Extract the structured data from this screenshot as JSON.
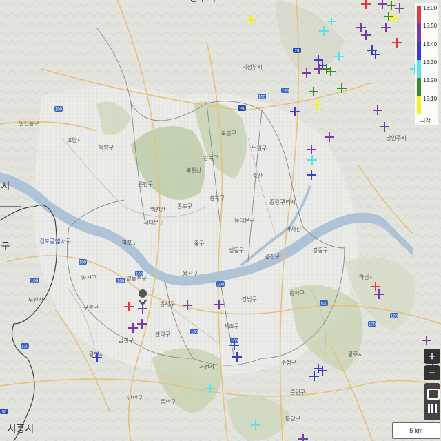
{
  "legend": {
    "caption": "시각",
    "ticks": [
      {
        "label": "16:00",
        "color": "#e8373a"
      },
      {
        "label": "15:50",
        "color": "#7a3aa8"
      },
      {
        "label": "15:40",
        "color": "#3a3ad8"
      },
      {
        "label": "15:30",
        "color": "#5de0e8"
      },
      {
        "label": "15:20",
        "color": "#3a8a2a"
      },
      {
        "label": "15:10",
        "color": "#f4f02a"
      }
    ]
  },
  "controls": {
    "zoom_in": "+",
    "zoom_out": "−"
  },
  "scale": {
    "label": "5 km"
  },
  "place_labels": [
    {
      "text": "의정부시",
      "size": "small"
    },
    {
      "text": "일산동구",
      "size": "small"
    },
    {
      "text": "고양시",
      "size": "small"
    },
    {
      "text": "덕양구",
      "size": "small"
    },
    {
      "text": "도봉구",
      "size": "small"
    },
    {
      "text": "노원구",
      "size": "small"
    },
    {
      "text": "강북구",
      "size": "small"
    },
    {
      "text": "은평구",
      "size": "small"
    },
    {
      "text": "성북구",
      "size": "small"
    },
    {
      "text": "종로구",
      "size": "small"
    },
    {
      "text": "중랑구",
      "size": "small"
    },
    {
      "text": "서대문구",
      "size": "small"
    },
    {
      "text": "동대문구",
      "size": "small"
    },
    {
      "text": "구리시",
      "size": "small"
    },
    {
      "text": "마포구",
      "size": "small"
    },
    {
      "text": "중구",
      "size": "small"
    },
    {
      "text": "성동구",
      "size": "small"
    },
    {
      "text": "광진구",
      "size": "small"
    },
    {
      "text": "강동구",
      "size": "small"
    },
    {
      "text": "하남시",
      "size": "small"
    },
    {
      "text": "김포공항",
      "size": "small"
    },
    {
      "text": "강서구",
      "size": "small"
    },
    {
      "text": "양천구",
      "size": "small"
    },
    {
      "text": "영등포구",
      "size": "small"
    },
    {
      "text": "용산구",
      "size": "small"
    },
    {
      "text": "부천시",
      "size": "small"
    },
    {
      "text": "구로구",
      "size": "small"
    },
    {
      "text": "동작구",
      "size": "small"
    },
    {
      "text": "강남구",
      "size": "small"
    },
    {
      "text": "송파구",
      "size": "small"
    },
    {
      "text": "서초구",
      "size": "small"
    },
    {
      "text": "금천구",
      "size": "small"
    },
    {
      "text": "관악구",
      "size": "small"
    },
    {
      "text": "광명시",
      "size": "small"
    },
    {
      "text": "과천시",
      "size": "small"
    },
    {
      "text": "수정구",
      "size": "small"
    },
    {
      "text": "중원구",
      "size": "small"
    },
    {
      "text": "남양주시",
      "size": "small"
    },
    {
      "text": "만안구",
      "size": "small"
    },
    {
      "text": "동안구",
      "size": "small"
    },
    {
      "text": "분당구",
      "size": "small"
    },
    {
      "text": "시흥시",
      "size": "big"
    },
    {
      "text": "시",
      "size": "big"
    },
    {
      "text": "구",
      "size": "big"
    },
    {
      "text": "양주시",
      "size": "big"
    },
    {
      "text": "광주시",
      "size": "small"
    },
    {
      "text": "중산",
      "size": "small"
    },
    {
      "text": "북한산",
      "size": "small"
    },
    {
      "text": "백련산",
      "size": "small"
    },
    {
      "text": "아차산",
      "size": "small"
    }
  ],
  "road_shields": [
    "29",
    "29",
    "100",
    "100",
    "100",
    "100",
    "100",
    "100",
    "100",
    "100",
    "100",
    "100",
    "100",
    "100",
    "100",
    "50",
    "130"
  ]
}
